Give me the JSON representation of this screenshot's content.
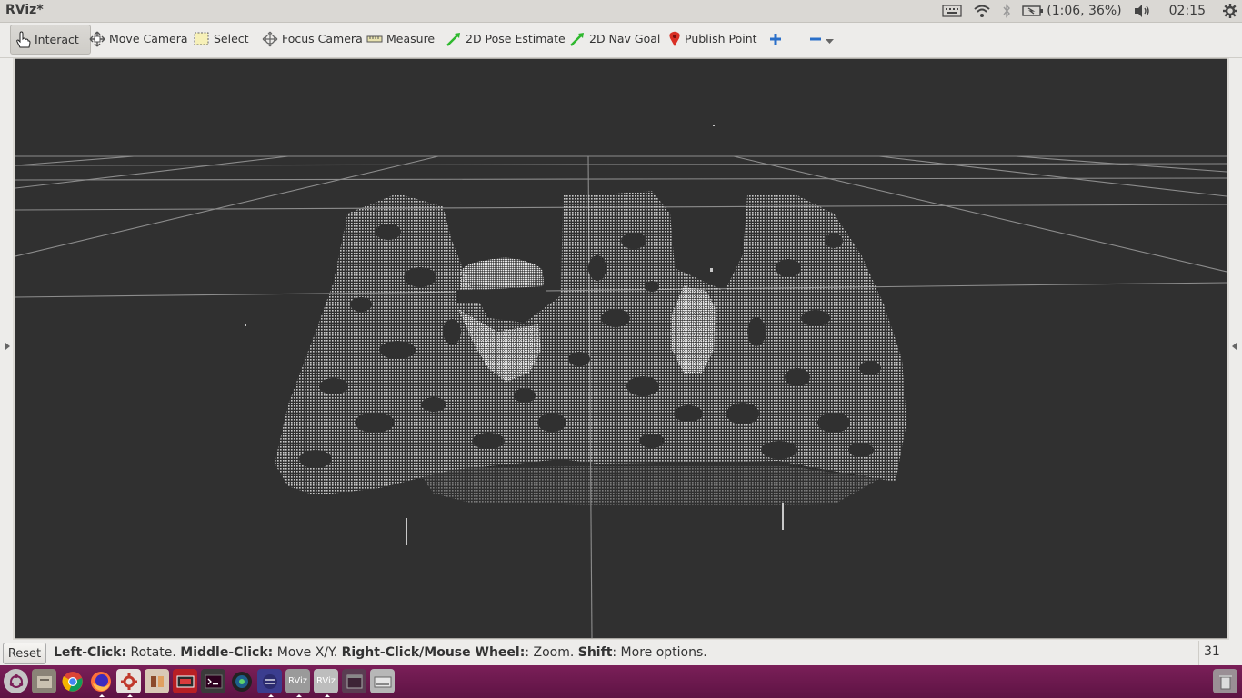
{
  "window": {
    "title": "RViz*"
  },
  "system_tray": {
    "battery_text": "(1:06, 36%)",
    "clock": "02:15"
  },
  "toolbar": {
    "tools": [
      {
        "label": "Interact",
        "icon": "hand-pointer-icon",
        "active": true
      },
      {
        "label": "Move Camera",
        "icon": "move-camera-icon"
      },
      {
        "label": "Select",
        "icon": "select-box-icon"
      },
      {
        "label": "Focus Camera",
        "icon": "focus-crosshair-icon"
      },
      {
        "label": "Measure",
        "icon": "ruler-icon"
      },
      {
        "label": "2D Pose Estimate",
        "icon": "green-arrow-icon"
      },
      {
        "label": "2D Nav Goal",
        "icon": "green-arrow-icon"
      },
      {
        "label": "Publish Point",
        "icon": "map-pin-icon"
      }
    ],
    "add_tool_icon": "plus-icon",
    "remove_tool_icon": "minus-icon"
  },
  "viewport": {
    "background": "#303030",
    "grid_color": "#8c8c8c",
    "point_color": "#d8d8d8"
  },
  "statusbar": {
    "reset_label": "Reset",
    "hint": {
      "left_click_key": "Left-Click:",
      "left_click_action": " Rotate. ",
      "middle_click_key": "Middle-Click:",
      "middle_click_action": " Move X/Y. ",
      "right_click_key": "Right-Click/Mouse Wheel:",
      "right_click_action": ": Zoom. ",
      "shift_key": "Shift",
      "shift_action": ": More options."
    },
    "fps": "31 fps"
  },
  "launcher": {
    "items": [
      "ubuntu-dash-icon",
      "files-icon",
      "chrome-icon",
      "firefox-icon",
      "settings-icon",
      "media-icon",
      "video-icon",
      "terminal-icon",
      "camera-lens-icon",
      "eclipse-icon",
      "rviz-icon",
      "rviz-icon",
      "window-icon",
      "drive-icon"
    ],
    "rviz_label": "RViz",
    "trash_icon": "trash-icon"
  }
}
